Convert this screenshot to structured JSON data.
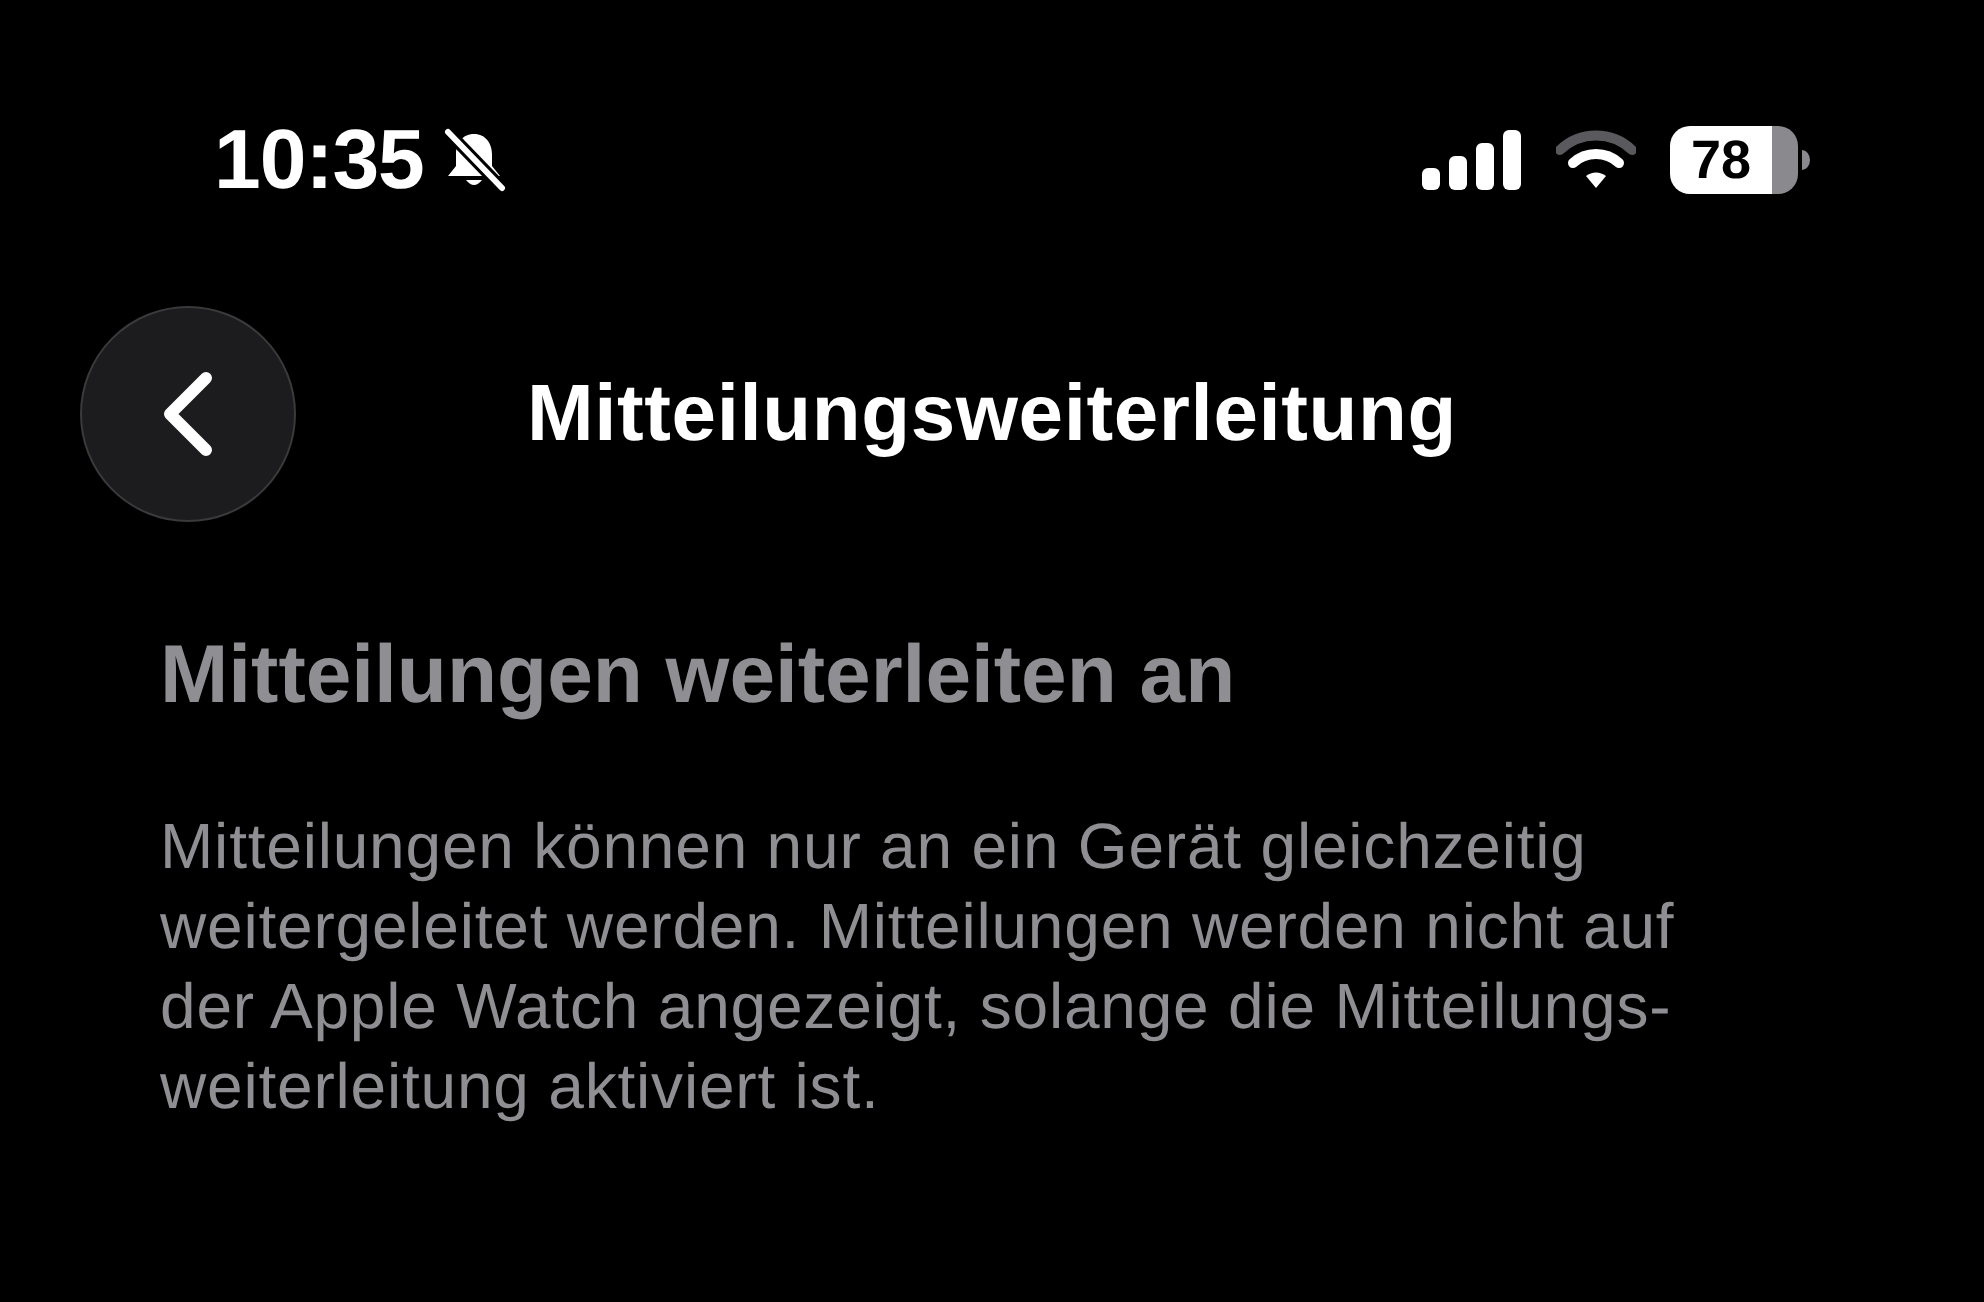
{
  "status_bar": {
    "time": "10:35",
    "battery_percent": "78"
  },
  "nav_bar": {
    "title": "Mitteilungsweiterleitung"
  },
  "section": {
    "heading": "Mitteilungen weiterleiten an",
    "description": "Mitteilungen können nur an ein Gerät gleichzeitig weitergeleitet werden. Mitteilungen werden nicht auf der Apple Watch angezeigt, solange die Mitteilungs-weiterleitung aktiviert ist."
  }
}
